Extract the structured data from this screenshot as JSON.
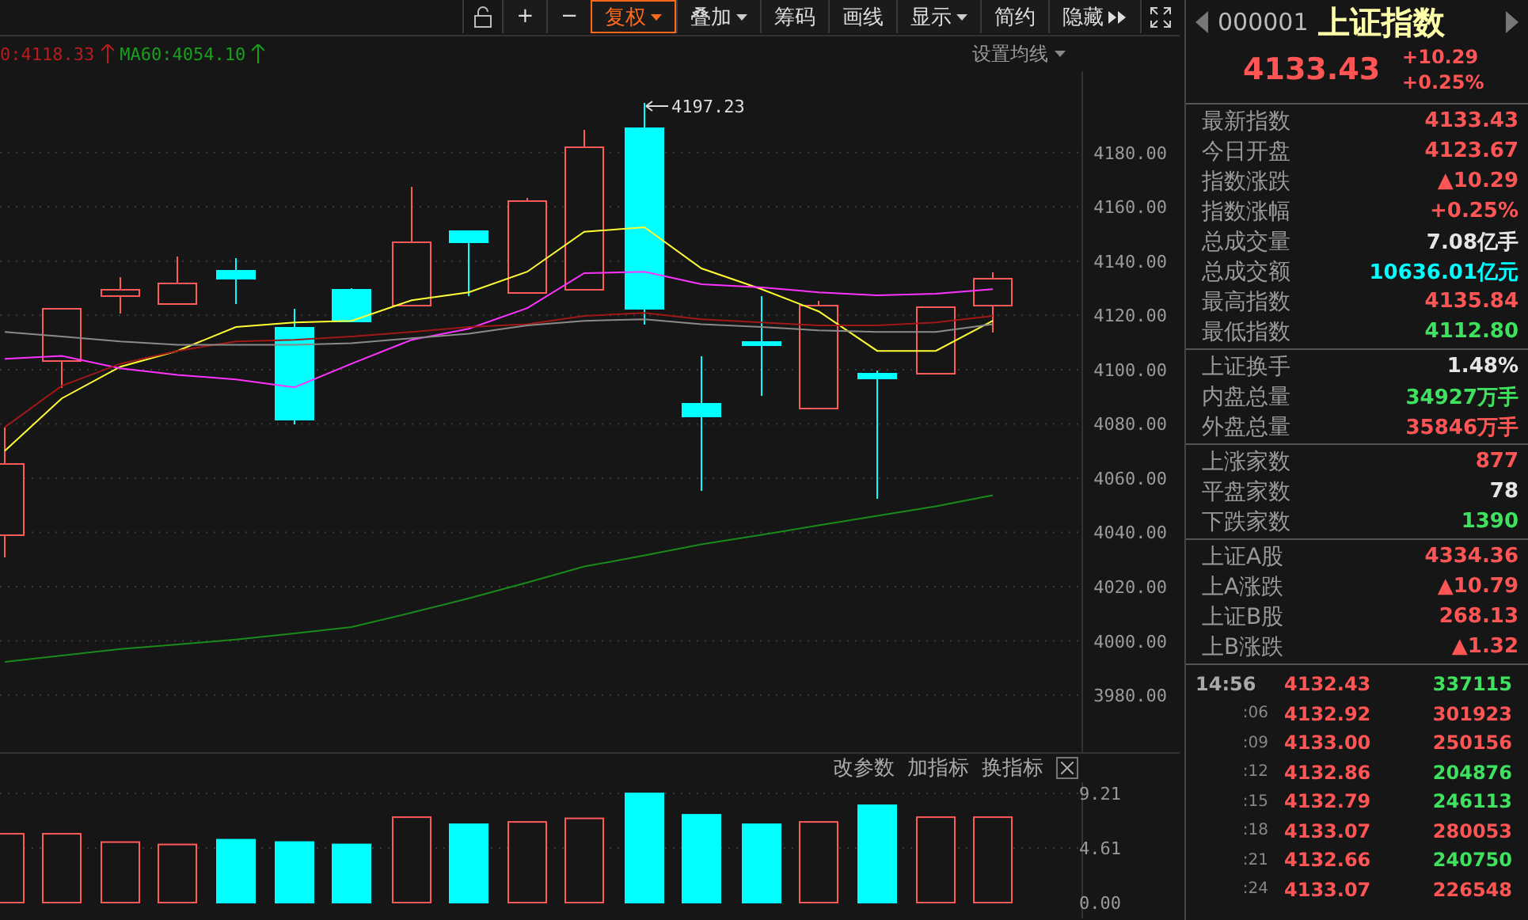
{
  "toolbar": {
    "buttons": [
      {
        "label": "+",
        "kind": "plain",
        "selected": false
      },
      {
        "label": "−",
        "kind": "plain",
        "selected": false
      },
      {
        "label": "复权",
        "kind": "dropdown",
        "selected": true
      },
      {
        "label": "叠加",
        "kind": "dropdown",
        "selected": false
      },
      {
        "label": "筹码",
        "kind": "plain",
        "selected": false
      },
      {
        "label": "画线",
        "kind": "plain",
        "selected": false
      },
      {
        "label": "显示",
        "kind": "dropdown",
        "selected": false
      },
      {
        "label": "简约",
        "kind": "plain",
        "selected": false
      },
      {
        "label": "隐藏",
        "kind": "expand",
        "selected": false
      }
    ]
  },
  "legend": [
    {
      "text": "0:4118.33",
      "color": "#b81c1c"
    },
    {
      "text": "MA60:4054.10",
      "color": "#18a01c"
    }
  ],
  "settings_link": "设置均线",
  "main_chart": {
    "high_label": "4197.23",
    "chart_data": {
      "type": "line",
      "ylim": [
        3959,
        4210
      ],
      "grid": true,
      "yticks": [
        {
          "value": 4180,
          "label": "4180.00"
        },
        {
          "value": 4160,
          "label": "4160.00"
        },
        {
          "value": 4140,
          "label": "4140.00"
        },
        {
          "value": 4120,
          "label": "4120.00"
        },
        {
          "value": 4100,
          "label": "4100.00"
        },
        {
          "value": 4080,
          "label": "4080.00"
        },
        {
          "value": 4060,
          "label": "4060.00"
        },
        {
          "value": 4040,
          "label": "4040.00"
        },
        {
          "value": 4020,
          "label": "4020.00"
        },
        {
          "value": 4000,
          "label": "4000.00"
        },
        {
          "value": 3980,
          "label": "3980.00"
        }
      ],
      "series": [
        {
          "color": "#ffff33",
          "values": [
            4070.1,
            4089.4,
            4101.1,
            4106.9,
            4115.7,
            4117.4,
            4118.0,
            4125.6,
            4128.5,
            4136.1,
            4150.8,
            4152.5,
            4137.3,
            4129.7,
            4121.5,
            4106.9,
            4106.9,
            4118.0
          ]
        },
        {
          "color": "#ff33ff",
          "values": [
            4104.0,
            4105.1,
            4100.5,
            4098.1,
            4096.4,
            4093.5,
            4102.2,
            4111.0,
            4115.1,
            4122.7,
            4135.6,
            4136.1,
            4131.5,
            4130.3,
            4128.5,
            4127.4,
            4128.0,
            4129.7
          ]
        },
        {
          "color": "#a01818",
          "values": [
            4078.8,
            4094.0,
            4102.2,
            4106.9,
            4110.4,
            4111.0,
            4112.2,
            4113.9,
            4115.7,
            4116.8,
            4119.8,
            4120.9,
            4118.6,
            4117.4,
            4116.3,
            4116.3,
            4117.4,
            4119.8
          ]
        },
        {
          "color": "#8a8a8a",
          "values": [
            4113.9,
            4112.2,
            4110.4,
            4109.2,
            4109.2,
            4109.2,
            4109.8,
            4111.6,
            4113.3,
            4116.3,
            4118.0,
            4118.6,
            4116.8,
            4115.7,
            4114.5,
            4113.9,
            4113.9,
            4116.8
          ]
        },
        {
          "color": "#1a8a1a",
          "values": [
            3992.3,
            3994.6,
            3997.0,
            3998.7,
            4000.5,
            4002.8,
            4005.1,
            4010.4,
            4015.7,
            4021.5,
            4027.4,
            4031.5,
            4035.6,
            4039.1,
            4042.6,
            4046.1,
            4049.6,
            4053.7
          ]
        }
      ]
    }
  },
  "volume_panel": {
    "actions": [
      "改参数",
      "加指标",
      "换指标"
    ],
    "chart_data": {
      "type": "bar",
      "ylim": [
        0,
        9.21
      ],
      "grid": true,
      "yticks": [
        {
          "value": 9.21,
          "label": "9.21"
        },
        {
          "value": 4.61,
          "label": "4.61"
        },
        {
          "value": 0,
          "label": "0.00"
        }
      ],
      "series": [
        {
          "values": [
            5.8,
            5.8,
            5.1,
            4.9,
            5.3,
            5.1,
            4.9,
            7.2,
            6.6,
            6.8,
            7.1,
            9.2,
            7.4,
            6.6,
            6.8,
            8.2,
            7.2,
            7.2
          ]
        }
      ]
    }
  },
  "quote": {
    "code": "000001",
    "name": "上证指数",
    "price": "4133.43",
    "change": "+10.29",
    "change_pct": "+0.25%"
  },
  "stat_sections": [
    [
      {
        "label": "最新指数",
        "value": "4133.43",
        "color": "#ff5555"
      },
      {
        "label": "今日开盘",
        "value": "4123.67",
        "color": "#ff5555"
      },
      {
        "label": "指数涨跌",
        "value": "▲10.29",
        "color": "#ff5555"
      },
      {
        "label": "指数涨幅",
        "value": "+0.25%",
        "color": "#ff5555"
      },
      {
        "label": "总成交量",
        "value": "7.08亿手",
        "color": "#e6e6e6"
      },
      {
        "label": "总成交额",
        "value": "10636.01亿元",
        "color": "#00ffff"
      },
      {
        "label": "最高指数",
        "value": "4135.84",
        "color": "#ff5555"
      },
      {
        "label": "最低指数",
        "value": "4112.80",
        "color": "#3ee25e"
      }
    ],
    [
      {
        "label": "上证换手",
        "value": "1.48%",
        "color": "#e6e6e6"
      },
      {
        "label": "内盘总量",
        "value": "34927万手",
        "color": "#3ee25e"
      },
      {
        "label": "外盘总量",
        "value": "35846万手",
        "color": "#ff5555"
      }
    ],
    [
      {
        "label": "上涨家数",
        "value": "877",
        "color": "#ff5555"
      },
      {
        "label": "平盘家数",
        "value": "78",
        "color": "#e6e6e6"
      },
      {
        "label": "下跌家数",
        "value": "1390",
        "color": "#3ee25e"
      }
    ],
    [
      {
        "label": "上证A股",
        "value": "4334.36",
        "color": "#ff5555"
      },
      {
        "label": "上A涨跌",
        "value": "▲10.79",
        "color": "#ff5555"
      },
      {
        "label": "上证B股",
        "value": "268.13",
        "color": "#ff5555"
      },
      {
        "label": "上B涨跌",
        "value": "▲1.32",
        "color": "#ff5555"
      }
    ]
  ],
  "ticks": [
    {
      "time": "14:56",
      "price": "4132.43",
      "volume": "337115",
      "color": "#3ee25e"
    },
    {
      "time": ":06",
      "price": "4132.92",
      "volume": "301923",
      "color": "#ff5555"
    },
    {
      "time": ":09",
      "price": "4133.00",
      "volume": "250156",
      "color": "#ff5555"
    },
    {
      "time": ":12",
      "price": "4132.86",
      "volume": "204876",
      "color": "#3ee25e"
    },
    {
      "time": ":15",
      "price": "4132.79",
      "volume": "246113",
      "color": "#3ee25e"
    },
    {
      "time": ":18",
      "price": "4133.07",
      "volume": "280053",
      "color": "#ff5555"
    },
    {
      "time": ":21",
      "price": "4132.66",
      "volume": "240750",
      "color": "#3ee25e"
    },
    {
      "time": ":24",
      "price": "4133.07",
      "volume": "226548",
      "color": "#ff5555"
    }
  ]
}
